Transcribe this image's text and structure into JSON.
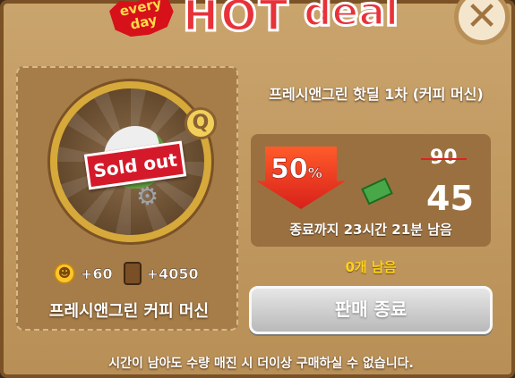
{
  "header": {
    "badge_text": "every day",
    "hot_text": "HOT",
    "deal_text": "deal",
    "close_label": "✕"
  },
  "item": {
    "soldout_stamp": "Sold out",
    "name": "프레시앤그린 커피 머신",
    "reward_exp": "+60",
    "reward_barrel": "+4050",
    "magnify_label": "Q"
  },
  "deal": {
    "title": "프레시앤그린 핫딜 1차 (커피 머신)",
    "discount_value": "50",
    "discount_unit": "%",
    "old_price": "90",
    "new_price": "45",
    "timer_text": "종료까지 23시간 21분 남음",
    "remaining_text": "0개 남음",
    "button_label": "판매 종료"
  },
  "footer": {
    "note": "시간이 남아도 수량 매진 시 더이상 구매하실 수 없습니다."
  },
  "colors": {
    "panel": "#c9a46c",
    "stamp": "#d41a2a",
    "discount": "#e8323a",
    "remaining": "#ffd21a",
    "button_disabled": "#c9c9c9"
  },
  "icons": [
    "close-icon",
    "magnify-icon",
    "gear-icon",
    "smile-icon",
    "barrel-icon",
    "money-icon",
    "star-icon"
  ]
}
